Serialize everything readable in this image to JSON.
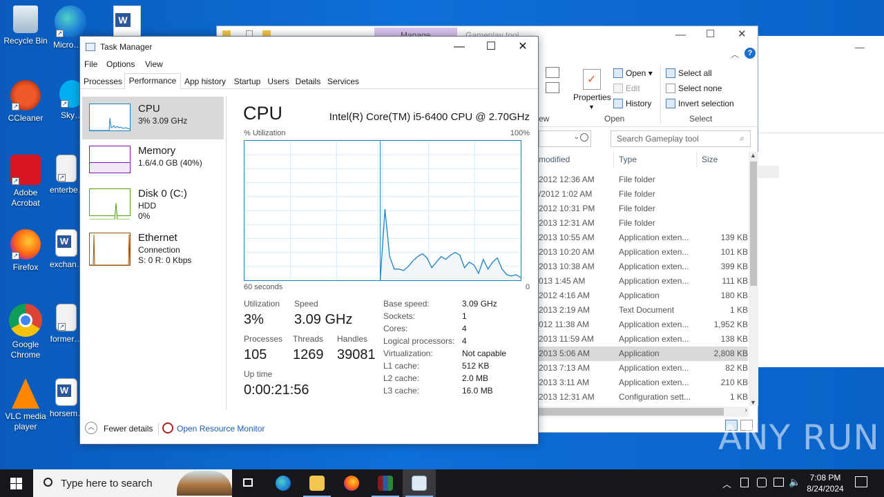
{
  "desktop": {
    "icons": [
      {
        "label": "Recycle Bin"
      },
      {
        "label": "Micro… Edge"
      },
      {
        "label": "CCleaner"
      },
      {
        "label": "Sky…"
      },
      {
        "label": "Adobe Acrobat"
      },
      {
        "label": "enterbe…"
      },
      {
        "label": "Firefox"
      },
      {
        "label": "exchan…"
      },
      {
        "label": "Google Chrome"
      },
      {
        "label": "former…"
      },
      {
        "label": "VLC media player"
      },
      {
        "label": "horsem…"
      }
    ]
  },
  "explorer": {
    "title_tab": "Manage",
    "title_text": "Gameplay tool",
    "ribbon": {
      "properties": "Properties",
      "open": "Open",
      "edit": "Edit",
      "history": "History",
      "select_all": "Select all",
      "select_none": "Select none",
      "invert_selection": "Invert selection",
      "group_view": "ew",
      "group_open": "Open",
      "group_select": "Select"
    },
    "search_placeholder": "Search Gameplay tool",
    "columns": {
      "modified": "modified",
      "type": "Type",
      "size": "Size"
    },
    "rows": [
      {
        "date": "2012 12:36 AM",
        "type": "File folder",
        "size": ""
      },
      {
        "date": "/2012 1:02 AM",
        "type": "File folder",
        "size": ""
      },
      {
        "date": "2012 10:31 PM",
        "type": "File folder",
        "size": ""
      },
      {
        "date": "2013 12:31 AM",
        "type": "File folder",
        "size": ""
      },
      {
        "date": "2013 10:55 AM",
        "type": "Application exten...",
        "size": "139 KB"
      },
      {
        "date": "2013 10:20 AM",
        "type": "Application exten...",
        "size": "101 KB"
      },
      {
        "date": "2013 10:38 AM",
        "type": "Application exten...",
        "size": "399 KB"
      },
      {
        "date": "013 1:45 AM",
        "type": "Application exten...",
        "size": "111 KB"
      },
      {
        "date": "2012 4:16 AM",
        "type": "Application",
        "size": "180 KB"
      },
      {
        "date": "2013 2:19 AM",
        "type": "Text Document",
        "size": "1 KB"
      },
      {
        "date": "012 11:38 AM",
        "type": "Application exten...",
        "size": "1,952 KB"
      },
      {
        "date": "2013 11:59 AM",
        "type": "Application exten...",
        "size": "138 KB"
      },
      {
        "date": "2013 5:06 AM",
        "type": "Application",
        "size": "2,808 KB"
      },
      {
        "date": "2013 7:13 AM",
        "type": "Application exten...",
        "size": "82 KB"
      },
      {
        "date": "2013 3:11 AM",
        "type": "Application exten...",
        "size": "210 KB"
      },
      {
        "date": "2013 12:31 AM",
        "type": "Configuration sett...",
        "size": "1 KB"
      }
    ]
  },
  "taskmanager": {
    "title": "Task Manager",
    "menu": [
      "File",
      "Options",
      "View"
    ],
    "tabs": [
      "Processes",
      "Performance",
      "App history",
      "Startup",
      "Users",
      "Details",
      "Services"
    ],
    "sidebar": {
      "cpu": {
        "name": "CPU",
        "sub": "3%  3.09 GHz"
      },
      "memory": {
        "name": "Memory",
        "sub": "1.6/4.0 GB (40%)"
      },
      "disk": {
        "name": "Disk 0 (C:)",
        "sub1": "HDD",
        "sub2": "0%"
      },
      "ethernet": {
        "name": "Ethernet",
        "sub1": "Connection",
        "sub2": "S: 0  R: 0 Kbps"
      }
    },
    "main": {
      "title": "CPU",
      "model": "Intel(R) Core(TM) i5-6400 CPU @ 2.70GHz",
      "util_label": "% Utilization",
      "util_max": "100%",
      "time_left": "60 seconds",
      "time_right": "0",
      "utilization_label": "Utilization",
      "utilization": "3%",
      "speed_label": "Speed",
      "speed": "3.09 GHz",
      "processes_label": "Processes",
      "processes": "105",
      "threads_label": "Threads",
      "threads": "1269",
      "handles_label": "Handles",
      "handles": "39081",
      "uptime_label": "Up time",
      "uptime": "0:00:21:56",
      "specs": [
        {
          "k": "Base speed:",
          "v": "3.09 GHz"
        },
        {
          "k": "Sockets:",
          "v": "1"
        },
        {
          "k": "Cores:",
          "v": "4"
        },
        {
          "k": "Logical processors:",
          "v": "4"
        },
        {
          "k": "Virtualization:",
          "v": "Not capable"
        },
        {
          "k": "L1 cache:",
          "v": "512 KB"
        },
        {
          "k": "L2 cache:",
          "v": "2.0 MB"
        },
        {
          "k": "L3 cache:",
          "v": "16.0 MB"
        }
      ]
    },
    "footer": {
      "fewer": "Fewer details",
      "resource_monitor": "Open Resource Monitor"
    },
    "chart_data": {
      "type": "area",
      "x": [
        0,
        1,
        2,
        3,
        4,
        5,
        6,
        7,
        8,
        9,
        10,
        11,
        12,
        13,
        14,
        15,
        16,
        17,
        18,
        19,
        20,
        21,
        22,
        23,
        24,
        25,
        26,
        27,
        28,
        29,
        30,
        31,
        32,
        33,
        34,
        35,
        36,
        37,
        38,
        39,
        40,
        41,
        42,
        43,
        44,
        45,
        46,
        47,
        48,
        49,
        50,
        51,
        52,
        53,
        54,
        55,
        56,
        57,
        58,
        59
      ],
      "values": [
        0,
        0,
        0,
        0,
        0,
        0,
        0,
        0,
        0,
        0,
        0,
        0,
        0,
        0,
        0,
        0,
        0,
        0,
        0,
        0,
        0,
        0,
        0,
        0,
        0,
        0,
        0,
        0,
        0,
        0,
        51,
        17,
        8,
        8,
        7,
        10,
        14,
        17,
        19,
        16,
        9,
        13,
        17,
        15,
        18,
        20,
        18,
        9,
        13,
        11,
        5,
        15,
        8,
        13,
        16,
        8,
        4,
        3,
        4,
        2
      ],
      "ylim": [
        0,
        100
      ],
      "xlabel": "60 seconds",
      "ylabel": "% Utilization",
      "color": "#1b81c4",
      "fill": "#f1f6fb"
    }
  },
  "taskbar": {
    "search_placeholder": "Type here to search",
    "time": "7:08 PM",
    "date": "8/24/2024"
  },
  "watermark": "ANY RUN",
  "colors": {
    "desktop": "#0d6fd8",
    "cpu_line": "#1b81c4",
    "memory_line": "#8b12ae",
    "disk_line": "#4da60c",
    "ethernet_line": "#a74f01"
  }
}
